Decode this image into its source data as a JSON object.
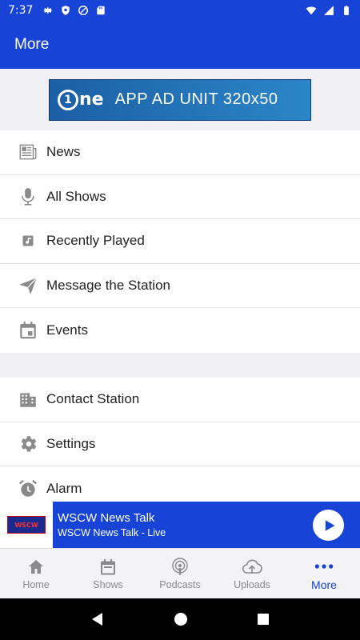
{
  "status_bar": {
    "time": "7:37"
  },
  "app_bar": {
    "title": "More"
  },
  "ad": {
    "logo_text": "ne",
    "logo_digit": "1",
    "text": "APP AD UNIT 320x50"
  },
  "menu_primary": [
    {
      "label": "News",
      "icon": "newspaper-icon"
    },
    {
      "label": "All Shows",
      "icon": "microphone-icon"
    },
    {
      "label": "Recently Played",
      "icon": "music-note-icon"
    },
    {
      "label": "Message the Station",
      "icon": "send-icon"
    },
    {
      "label": "Events",
      "icon": "calendar-icon"
    }
  ],
  "menu_secondary": [
    {
      "label": "Contact Station",
      "icon": "building-icon"
    },
    {
      "label": "Settings",
      "icon": "gear-icon"
    },
    {
      "label": "Alarm",
      "icon": "alarm-clock-icon"
    }
  ],
  "player": {
    "title": "WSCW News Talk",
    "subtitle": "WSCW News Talk - Live",
    "thumb_text": "WSCW"
  },
  "bottom_nav": [
    {
      "label": "Home",
      "icon": "home-icon",
      "active": false
    },
    {
      "label": "Shows",
      "icon": "calendar-icon",
      "active": false
    },
    {
      "label": "Podcasts",
      "icon": "podcast-icon",
      "active": false
    },
    {
      "label": "Uploads",
      "icon": "cloud-upload-icon",
      "active": false
    },
    {
      "label": "More",
      "icon": "more-dots-icon",
      "active": true
    }
  ],
  "colors": {
    "primary": "#1744d6",
    "icon_gray": "#8a8a8a"
  }
}
